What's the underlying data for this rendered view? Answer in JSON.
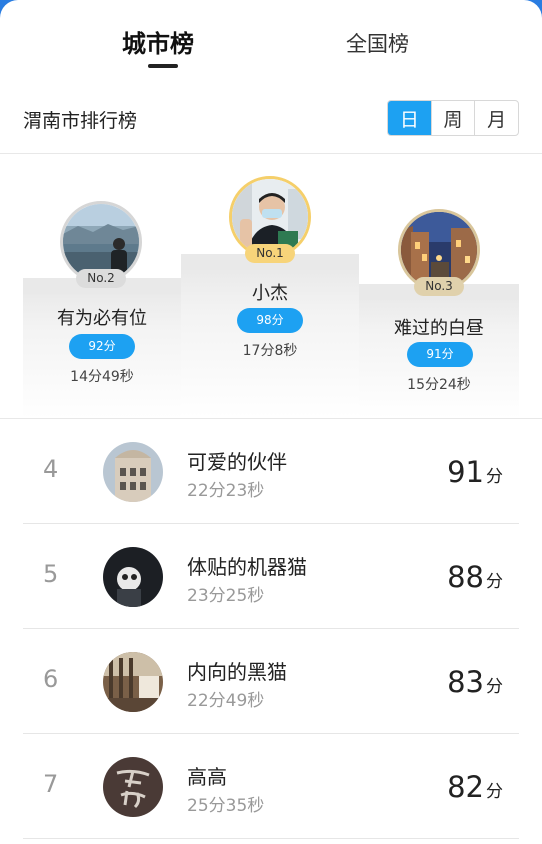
{
  "tabs": [
    {
      "label": "城市榜",
      "active": true
    },
    {
      "label": "全国榜",
      "active": false
    }
  ],
  "header": {
    "title": "渭南市排行榜",
    "periods": [
      {
        "label": "日",
        "active": true
      },
      {
        "label": "周",
        "active": false
      },
      {
        "label": "月",
        "active": false
      }
    ]
  },
  "podium": {
    "first": {
      "badge": "No.1",
      "name": "小杰",
      "score": "98分",
      "time": "17分8秒"
    },
    "second": {
      "badge": "No.2",
      "name": "有为必有位",
      "score": "92分",
      "time": "14分49秒"
    },
    "third": {
      "badge": "No.3",
      "name": "难过的白昼",
      "score": "91分",
      "time": "15分24秒"
    }
  },
  "list": [
    {
      "rank": "4",
      "name": "可爱的伙伴",
      "time": "22分23秒",
      "score": "91",
      "unit": "分"
    },
    {
      "rank": "5",
      "name": "体贴的机器猫",
      "time": "23分25秒",
      "score": "88",
      "unit": "分"
    },
    {
      "rank": "6",
      "name": "内向的黑猫",
      "time": "22分49秒",
      "score": "83",
      "unit": "分"
    },
    {
      "rank": "7",
      "name": "高高",
      "time": "25分35秒",
      "score": "82",
      "unit": "分"
    }
  ],
  "colors": {
    "accent": "#1da1f2",
    "gold": "#f7d47a",
    "silver": "#dcdcdc",
    "bronze": "#e0d1ac"
  }
}
